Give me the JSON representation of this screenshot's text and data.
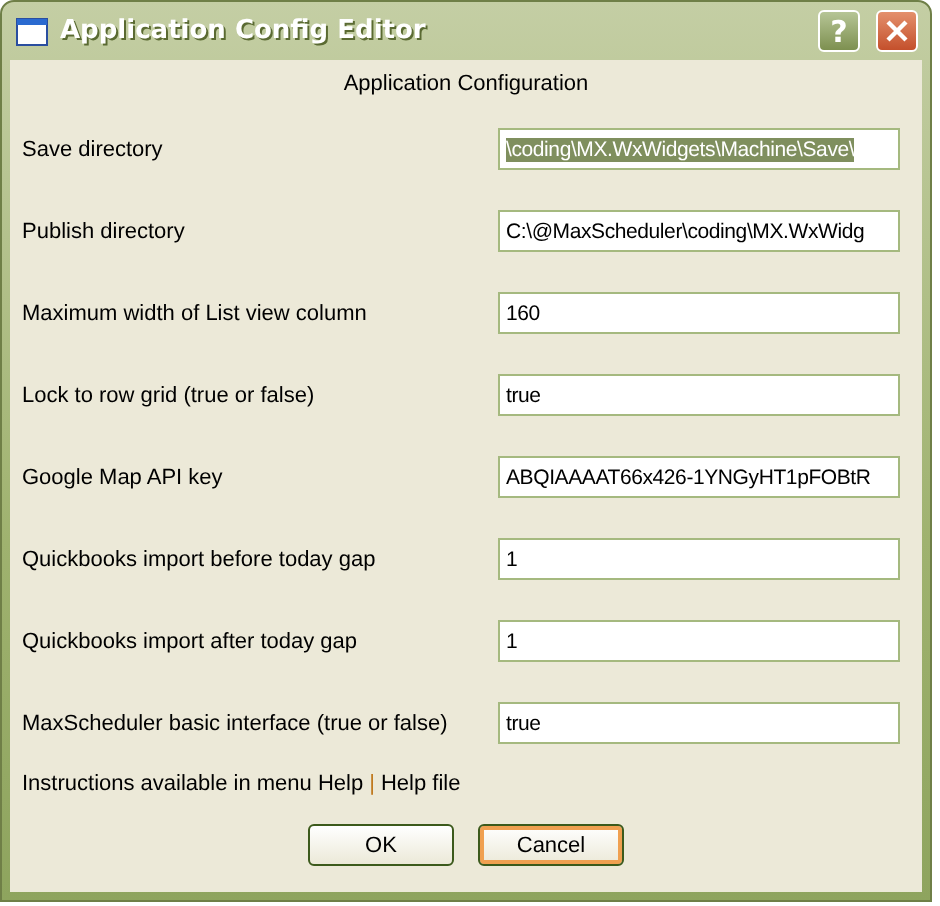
{
  "window": {
    "title": "Application Config Editor",
    "help_button": "?"
  },
  "heading": "Application Configuration",
  "settings": [
    {
      "label": "Save directory",
      "value": "\\coding\\MX.WxWidgets\\Machine\\Save\\",
      "text_selected": true
    },
    {
      "label": "Publish directory",
      "value": "C:\\@MaxScheduler\\coding\\MX.WxWidg",
      "text_selected": false
    },
    {
      "label": "Maximum width of List view column",
      "value": "160",
      "text_selected": false
    },
    {
      "label": "Lock to row grid (true or false)",
      "value": "true",
      "text_selected": false
    },
    {
      "label": "Google Map API key",
      "value": "ABQIAAAAT66x426-1YNGyHT1pFOBtR",
      "text_selected": false
    },
    {
      "label": "Quickbooks import before today gap",
      "value": "1",
      "text_selected": false
    },
    {
      "label": "Quickbooks import after today gap",
      "value": "1",
      "text_selected": false
    },
    {
      "label": "MaxScheduler basic interface (true or false)",
      "value": "true",
      "text_selected": false
    }
  ],
  "instructions": {
    "text": "Instructions available in menu Help",
    "separator": "|",
    "link": "Help file"
  },
  "buttons": [
    {
      "label": "OK",
      "focused": false
    },
    {
      "label": "Cancel",
      "focused": true
    }
  ]
}
